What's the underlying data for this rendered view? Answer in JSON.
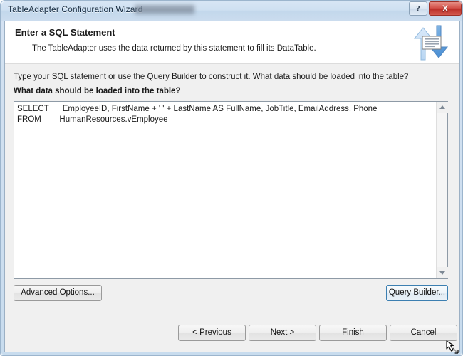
{
  "window": {
    "title": "TableAdapter Configuration Wizard",
    "redacted_title_suffix": "",
    "help_label": "?",
    "close_label": "X"
  },
  "header": {
    "title": "Enter a SQL Statement",
    "subtitle": "The TableAdapter uses the data returned by this statement to fill its DataTable.",
    "icon": "data-transfer-arrows-icon"
  },
  "body": {
    "instruction": "Type your SQL statement or use the Query Builder to construct it. What data should be loaded into the table?",
    "prompt": "What data should be loaded into the table?",
    "sql_statement": "SELECT      EmployeeID, FirstName + ' ' + LastName AS FullName, JobTitle, EmailAddress, Phone\nFROM        HumanResources.vEmployee",
    "scrollbar": {
      "up_icon": "scroll-up-arrow-icon",
      "down_icon": "scroll-down-arrow-icon"
    }
  },
  "actions": {
    "advanced_options": "Advanced Options...",
    "query_builder": "Query Builder..."
  },
  "footer": {
    "previous": "< Previous",
    "next": "Next >",
    "finish": "Finish",
    "cancel": "Cancel"
  },
  "colors": {
    "title_bar": "#cfdff0",
    "close_button": "#bb2f28",
    "focus_border": "#3c7fb1",
    "body_background": "#f0f0f0",
    "editor_background": "#ffffff"
  }
}
